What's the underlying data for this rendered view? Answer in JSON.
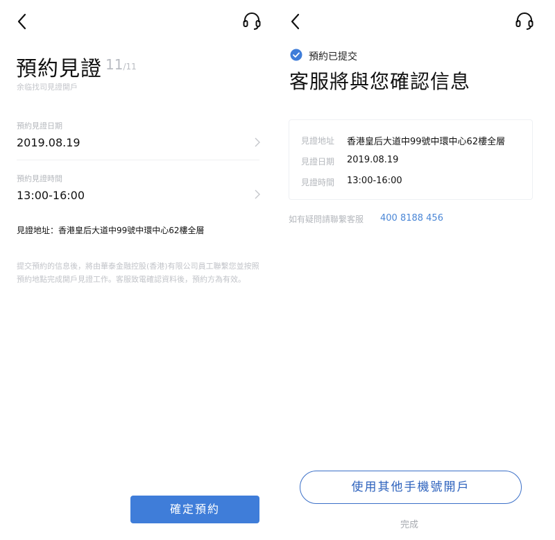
{
  "left": {
    "title": "預約見證",
    "step_current": "11",
    "step_total": "/11",
    "subtitle": "余临找司見證開戶",
    "date_label": "預約見證日期",
    "date_value": "2019.08.19",
    "time_label": "預約見證時間",
    "time_value": "13:00-16:00",
    "address": "見證地址：香港皇后大道中99號中環中心62樓全層",
    "notice": "提交預約的信息後，將由華泰金融控股(香港)有限公司員工聯繫您並按照預約地點完成開戶見證工作。客服致電確認資料後，預約方為有效。",
    "confirm_button": "確定預約"
  },
  "right": {
    "status_text": "預約已提交",
    "title": "客服將與您確認信息",
    "address_label": "見證地址",
    "address_value": "香港皇后大道中99號中環中心62樓全層",
    "date_label": "見證日期",
    "date_value": "2019.08.19",
    "time_label": "見證時間",
    "time_value": "13:00-16:00",
    "contact_text": "如有疑問請聯繫客服",
    "contact_phone": "400 8188 456",
    "other_phone_button": "使用其他手機號開戶",
    "done_link": "完成"
  },
  "colors": {
    "accent": "#3f7dd9",
    "link": "#4a86d6",
    "muted": "#b5b8bd"
  },
  "icons": [
    "back-arrow-icon",
    "headset-icon",
    "chevron-right-icon",
    "check-circle-icon"
  ]
}
